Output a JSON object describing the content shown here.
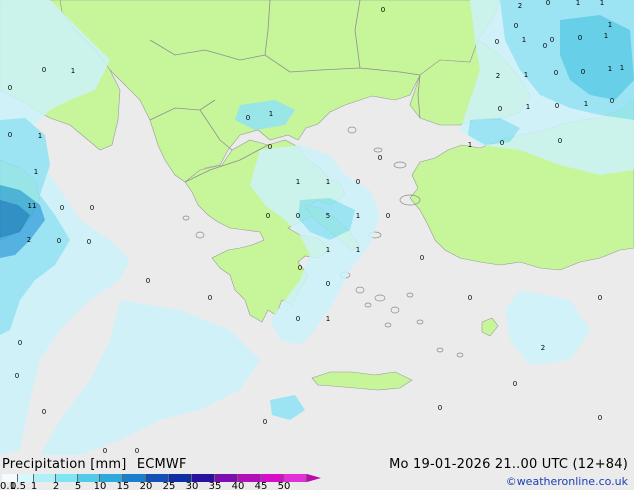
{
  "header": {
    "title": "Precipitation [mm]",
    "model": "ECMWF",
    "validity": "Mo 19-01-2026 21..00 UTC (12+84)",
    "credit": "©weatheronline.co.uk"
  },
  "legend": {
    "labels": [
      "0.1",
      "0.5",
      "1",
      "2",
      "5",
      "10",
      "15",
      "20",
      "25",
      "30",
      "35",
      "40",
      "45",
      "50"
    ],
    "colors": [
      "#f5fcfd",
      "#d6f7fb",
      "#aef0f8",
      "#7fe4f3",
      "#52cbe8",
      "#2fa8dc",
      "#1a7fcc",
      "#1450b8",
      "#0f2ea6",
      "#2a10a0",
      "#7b0fb0",
      "#b30fb8",
      "#d60ec9",
      "#e22fd8"
    ]
  },
  "map": {
    "colors": {
      "sea": "#ebebeb",
      "land": "#c6f59a",
      "precip_light": "#cdf3fb",
      "precip_mid": "#8fe3f5",
      "precip_heavy": "#3aa8e0",
      "border": "#9a9a9a"
    },
    "values": [
      "0",
      "0",
      "0",
      "0",
      "2",
      "0",
      "1",
      "1",
      "0",
      "1",
      "1",
      "0",
      "0",
      "1",
      "2",
      "1",
      "0",
      "0",
      "1",
      "1",
      "1",
      "0",
      "0",
      "1",
      "0",
      "1",
      "1",
      "0",
      "1",
      "1",
      "0",
      "0",
      "0",
      "0",
      "0",
      "0",
      "1",
      "0",
      "11",
      "0",
      "0",
      "2",
      "0",
      "0",
      "0",
      "0",
      "0",
      "1",
      "0",
      "1",
      "0",
      "0",
      "0",
      "0",
      "1",
      "1",
      "0",
      "0",
      "1",
      "0",
      "5",
      "1",
      "0",
      "0",
      "0",
      "2",
      "0",
      "0",
      "0",
      "0",
      "0",
      "0"
    ]
  }
}
